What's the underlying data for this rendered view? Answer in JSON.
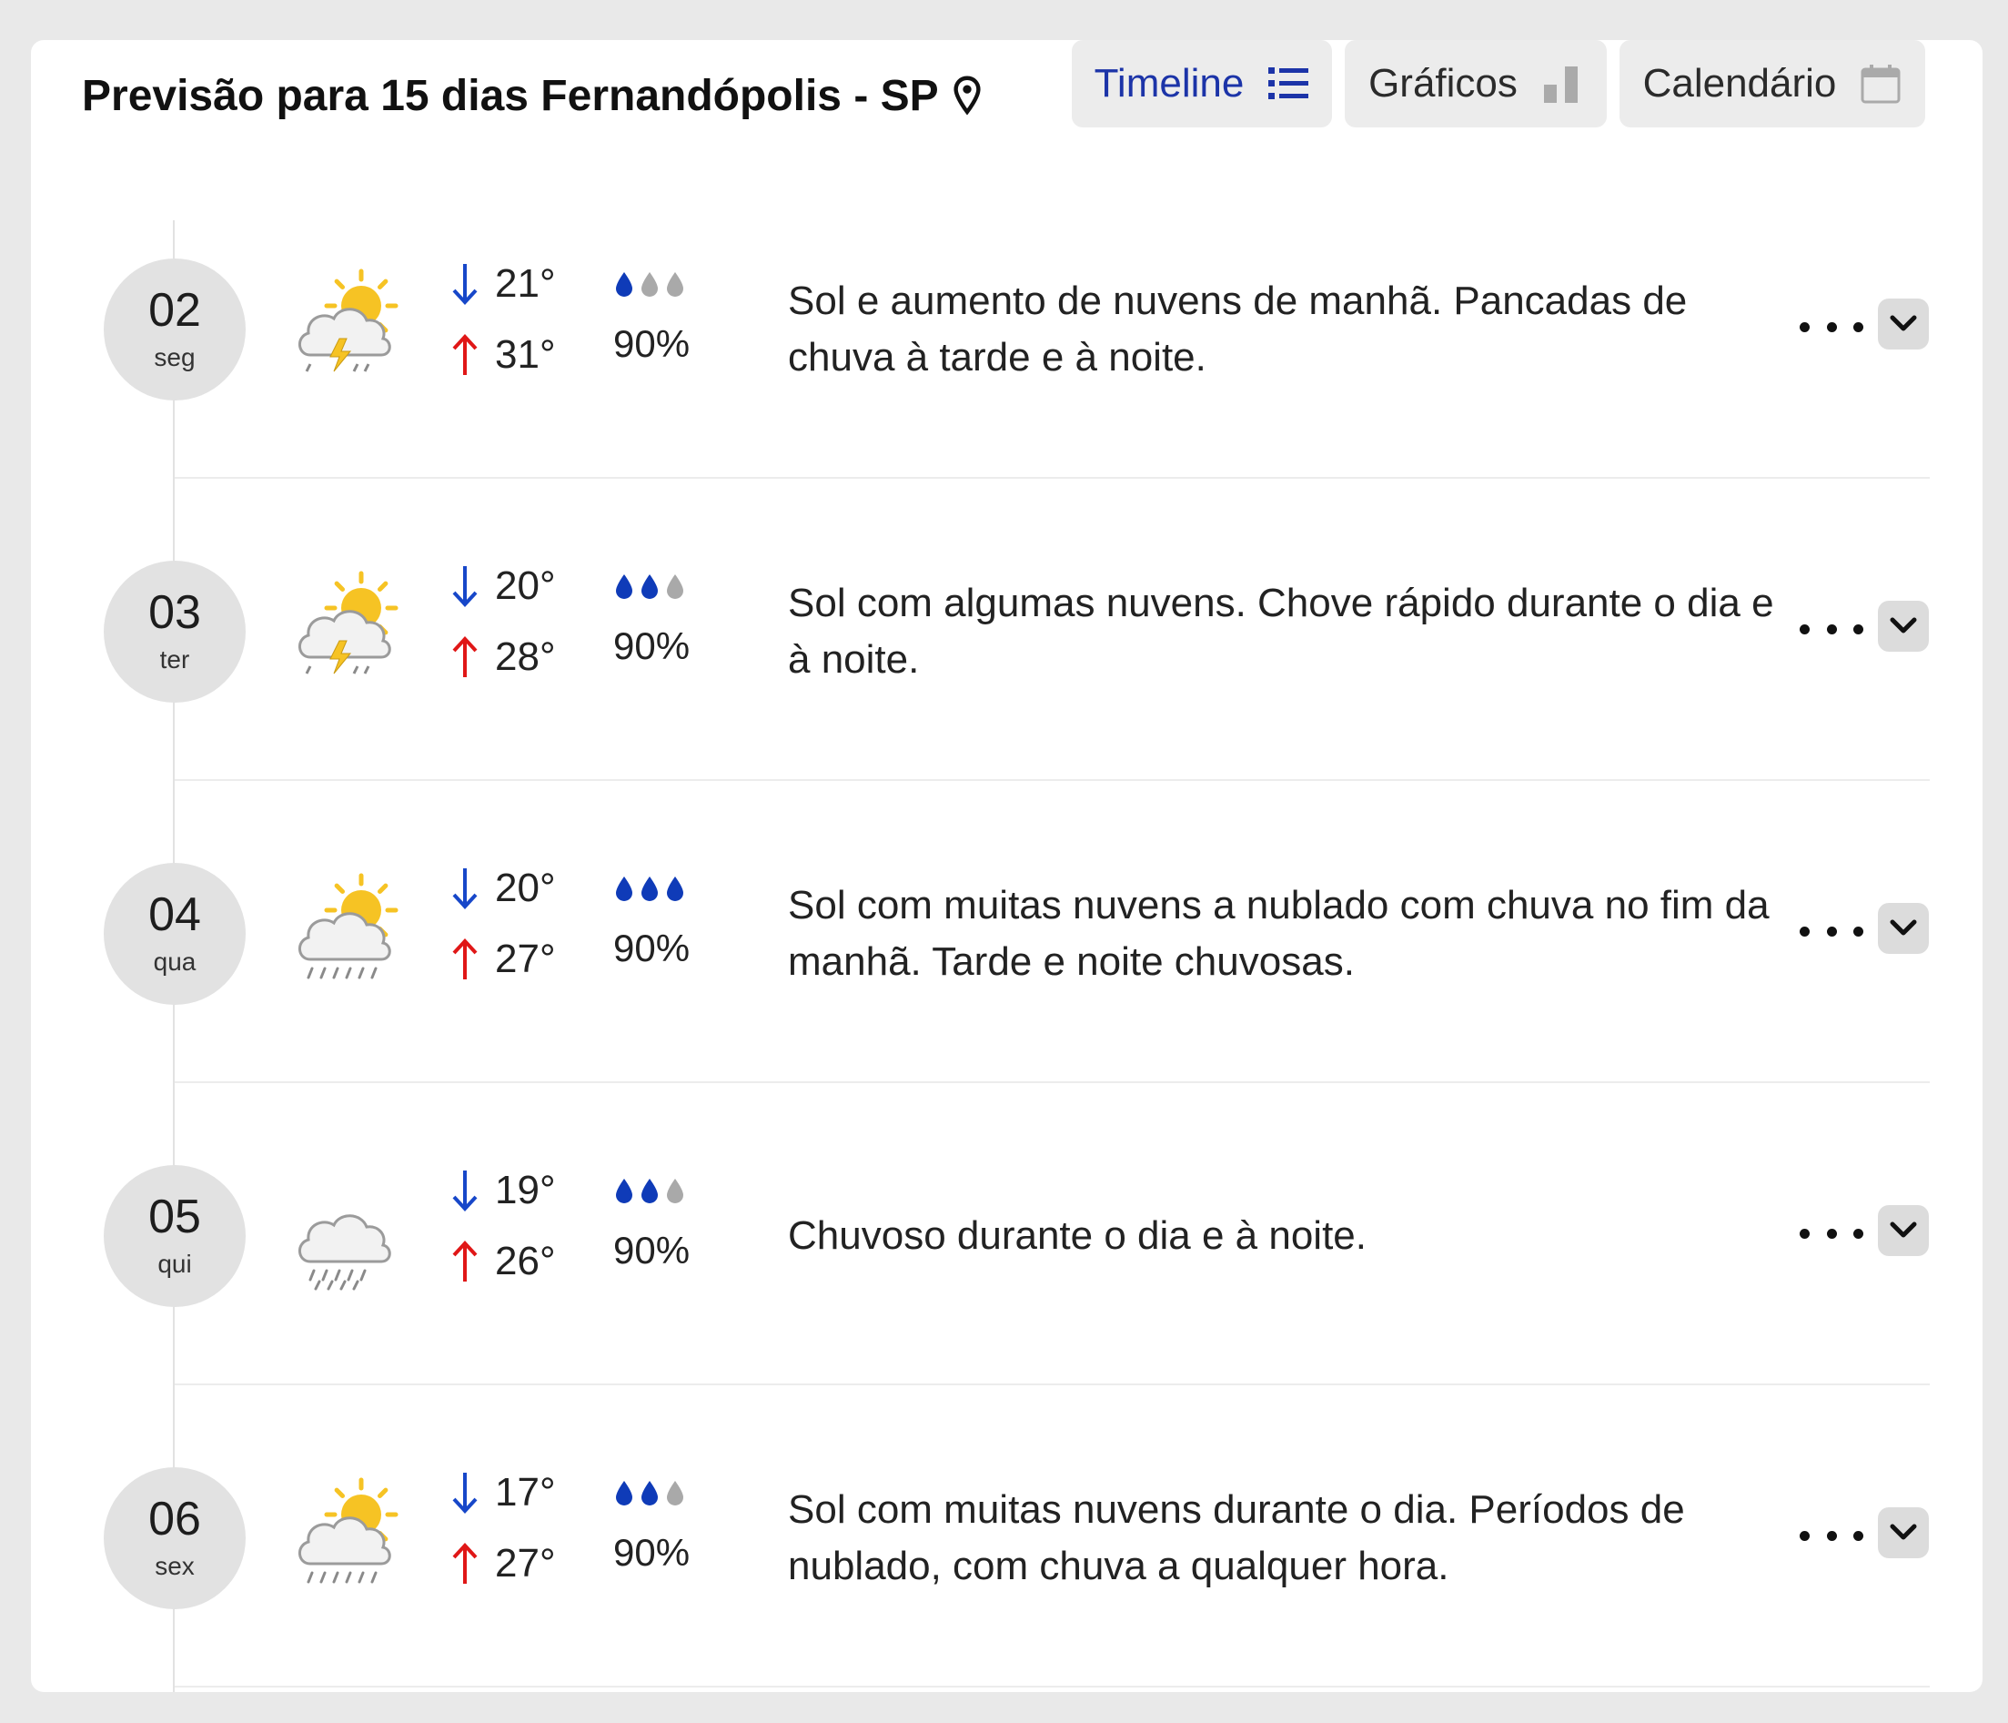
{
  "header": {
    "title": "Previsão para 15 dias Fernandópolis - SP",
    "location_icon": "map-pin-icon"
  },
  "tabs": [
    {
      "label": "Timeline",
      "icon": "list-icon",
      "active": true
    },
    {
      "label": "Gráficos",
      "icon": "bar-chart-icon",
      "active": false
    },
    {
      "label": "Calendário",
      "icon": "calendar-icon",
      "active": false
    }
  ],
  "colors": {
    "accent": "#1c34a8",
    "temp_min_arrow": "#1747c9",
    "temp_max_arrow": "#e01717",
    "drop_filled": "#0f3bb8",
    "drop_empty": "#a9a9a9",
    "sun": "#f6c324"
  },
  "days": [
    {
      "day": "02",
      "weekday": "seg",
      "icon": "sun-cloud-thunder-icon",
      "min": "21°",
      "max": "31°",
      "rain_prob": "90%",
      "rain_level": 1,
      "description": "Sol e aumento de nuvens de manhã. Pancadas de chuva à tarde e à noite."
    },
    {
      "day": "03",
      "weekday": "ter",
      "icon": "sun-cloud-thunder-icon",
      "min": "20°",
      "max": "28°",
      "rain_prob": "90%",
      "rain_level": 2,
      "description": "Sol com algumas nuvens. Chove rápido durante o dia e à noite."
    },
    {
      "day": "04",
      "weekday": "qua",
      "icon": "sun-cloud-rain-icon",
      "min": "20°",
      "max": "27°",
      "rain_prob": "90%",
      "rain_level": 3,
      "description": "Sol com muitas nuvens a nublado com chuva no fim da manhã. Tarde e noite chuvosas."
    },
    {
      "day": "05",
      "weekday": "qui",
      "icon": "cloud-rain-icon",
      "min": "19°",
      "max": "26°",
      "rain_prob": "90%",
      "rain_level": 2,
      "description": "Chuvoso durante o dia e à noite."
    },
    {
      "day": "06",
      "weekday": "sex",
      "icon": "sun-cloud-rain-icon",
      "min": "17°",
      "max": "27°",
      "rain_prob": "90%",
      "rain_level": 2,
      "description": "Sol com muitas nuvens durante o dia. Períodos de nublado, com chuva a qualquer hora."
    }
  ]
}
